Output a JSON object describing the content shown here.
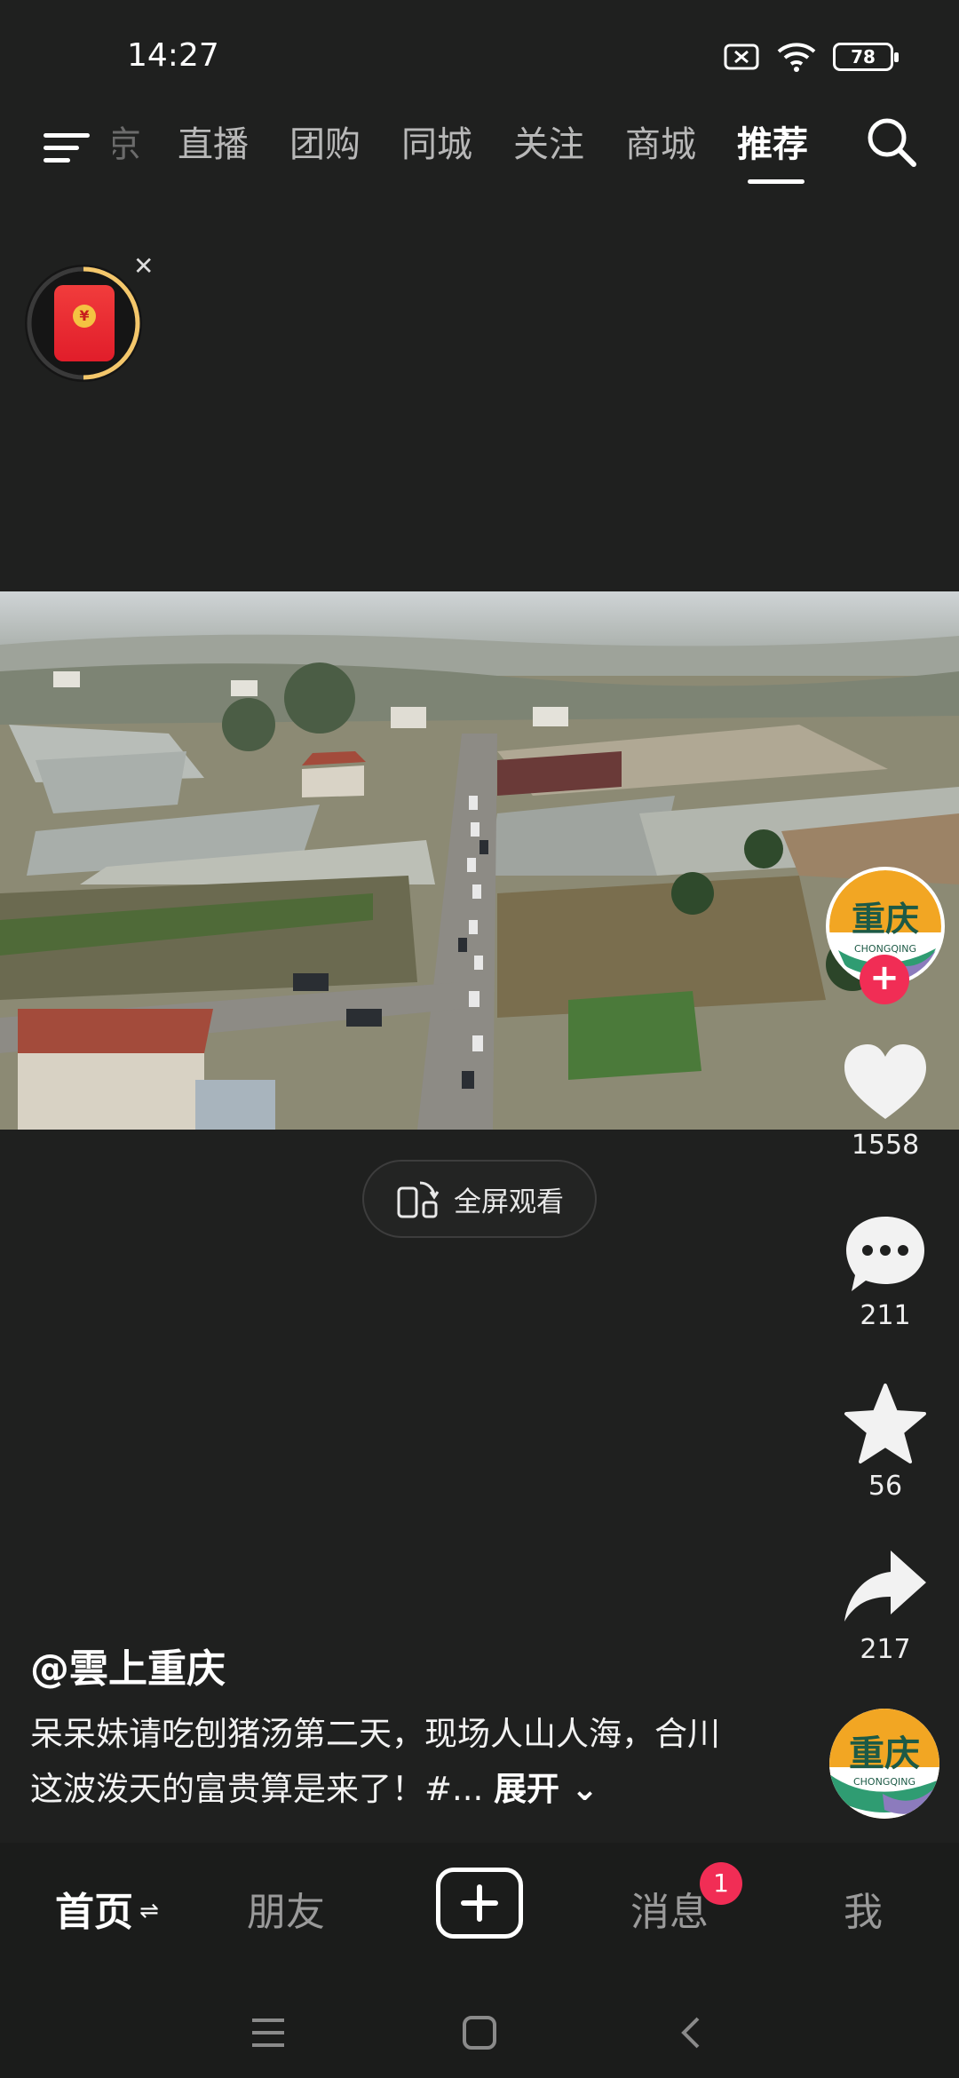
{
  "status_bar": {
    "time": "14:27",
    "battery": "78",
    "icons": [
      "sim-x-icon",
      "wifi-icon",
      "battery-icon"
    ]
  },
  "top_nav": {
    "tabs": [
      {
        "label": "直播"
      },
      {
        "label": "团购"
      },
      {
        "label": "同城"
      },
      {
        "label": "关注"
      },
      {
        "label": "商城"
      },
      {
        "label": "推荐",
        "active": true
      }
    ],
    "cut_off_tab": "京"
  },
  "video": {
    "fullscreen_label": "全屏观看"
  },
  "creator": {
    "avatar_text": "重庆",
    "avatar_subtext": "CHONGQING"
  },
  "actions": {
    "likes": "1558",
    "comments": "211",
    "favorites": "56",
    "shares": "217"
  },
  "caption": {
    "author": "@雲上重庆",
    "text": "呆呆妹请吃刨猪汤第二天，现场人山人海，合川这波泼天的富贵算是来了！#...",
    "expand_label": "展开"
  },
  "bottom_nav": {
    "items": [
      {
        "label": "首页",
        "active": true
      },
      {
        "label": "朋友"
      },
      {
        "label": "消息"
      },
      {
        "label": "我"
      }
    ],
    "message_badge": "1"
  },
  "colors": {
    "background": "#1f201f",
    "accent": "#f12d55",
    "redpacket": "#e11d2a"
  }
}
